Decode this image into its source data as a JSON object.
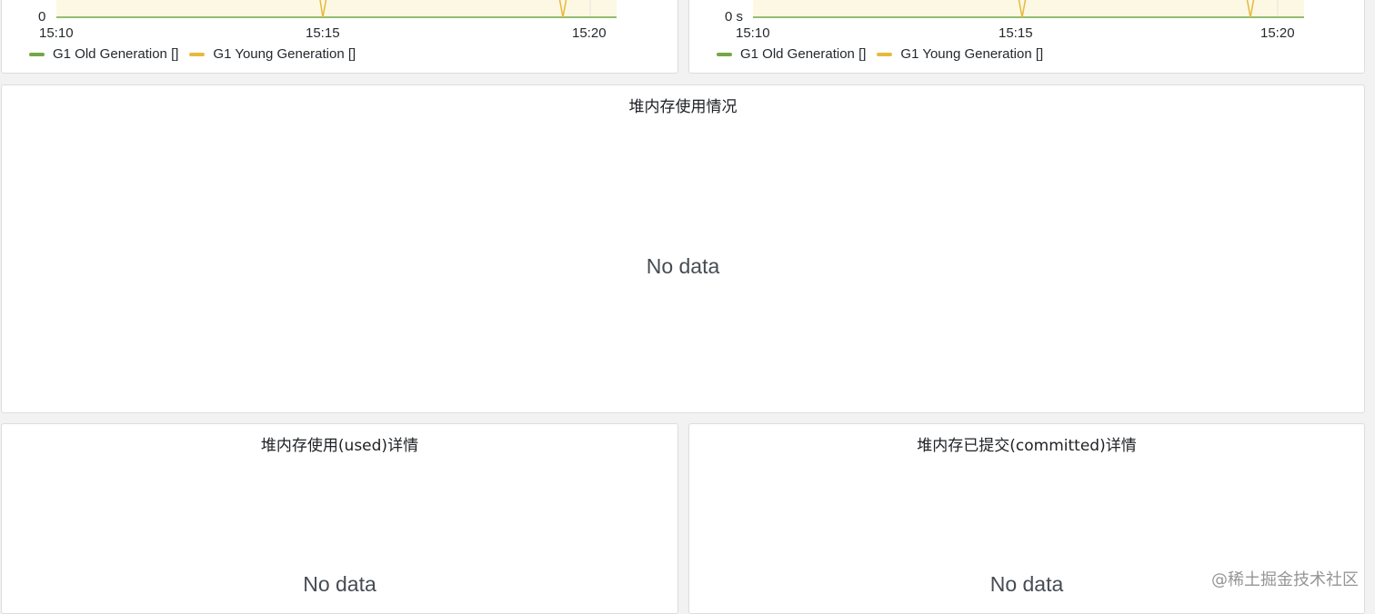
{
  "colors": {
    "old_gen": "#73a747",
    "young_gen": "#e8b93c",
    "plot_fill": "#fcf8e3"
  },
  "panels_top": [
    {
      "y_tick_label": "0",
      "x_tick_labels": [
        "15:10",
        "15:15",
        "15:20"
      ],
      "legend": [
        {
          "label": "G1 Old Generation []",
          "color": "#73a747"
        },
        {
          "label": "G1 Young Generation []",
          "color": "#e8b93c"
        }
      ]
    },
    {
      "y_tick_label": "0 s",
      "x_tick_labels": [
        "15:10",
        "15:15",
        "15:20"
      ],
      "legend": [
        {
          "label": "G1 Old Generation []",
          "color": "#73a747"
        },
        {
          "label": "G1 Young Generation []",
          "color": "#e8b93c"
        }
      ]
    }
  ],
  "panel_heap_usage": {
    "title": "堆内存使用情况",
    "no_data": "No data"
  },
  "panel_heap_used": {
    "title": "堆内存使用(used)详情",
    "no_data": "No data"
  },
  "panel_heap_committed": {
    "title": "堆内存已提交(committed)详情",
    "no_data": "No data"
  },
  "watermark": "@稀土掘金技术社区"
}
